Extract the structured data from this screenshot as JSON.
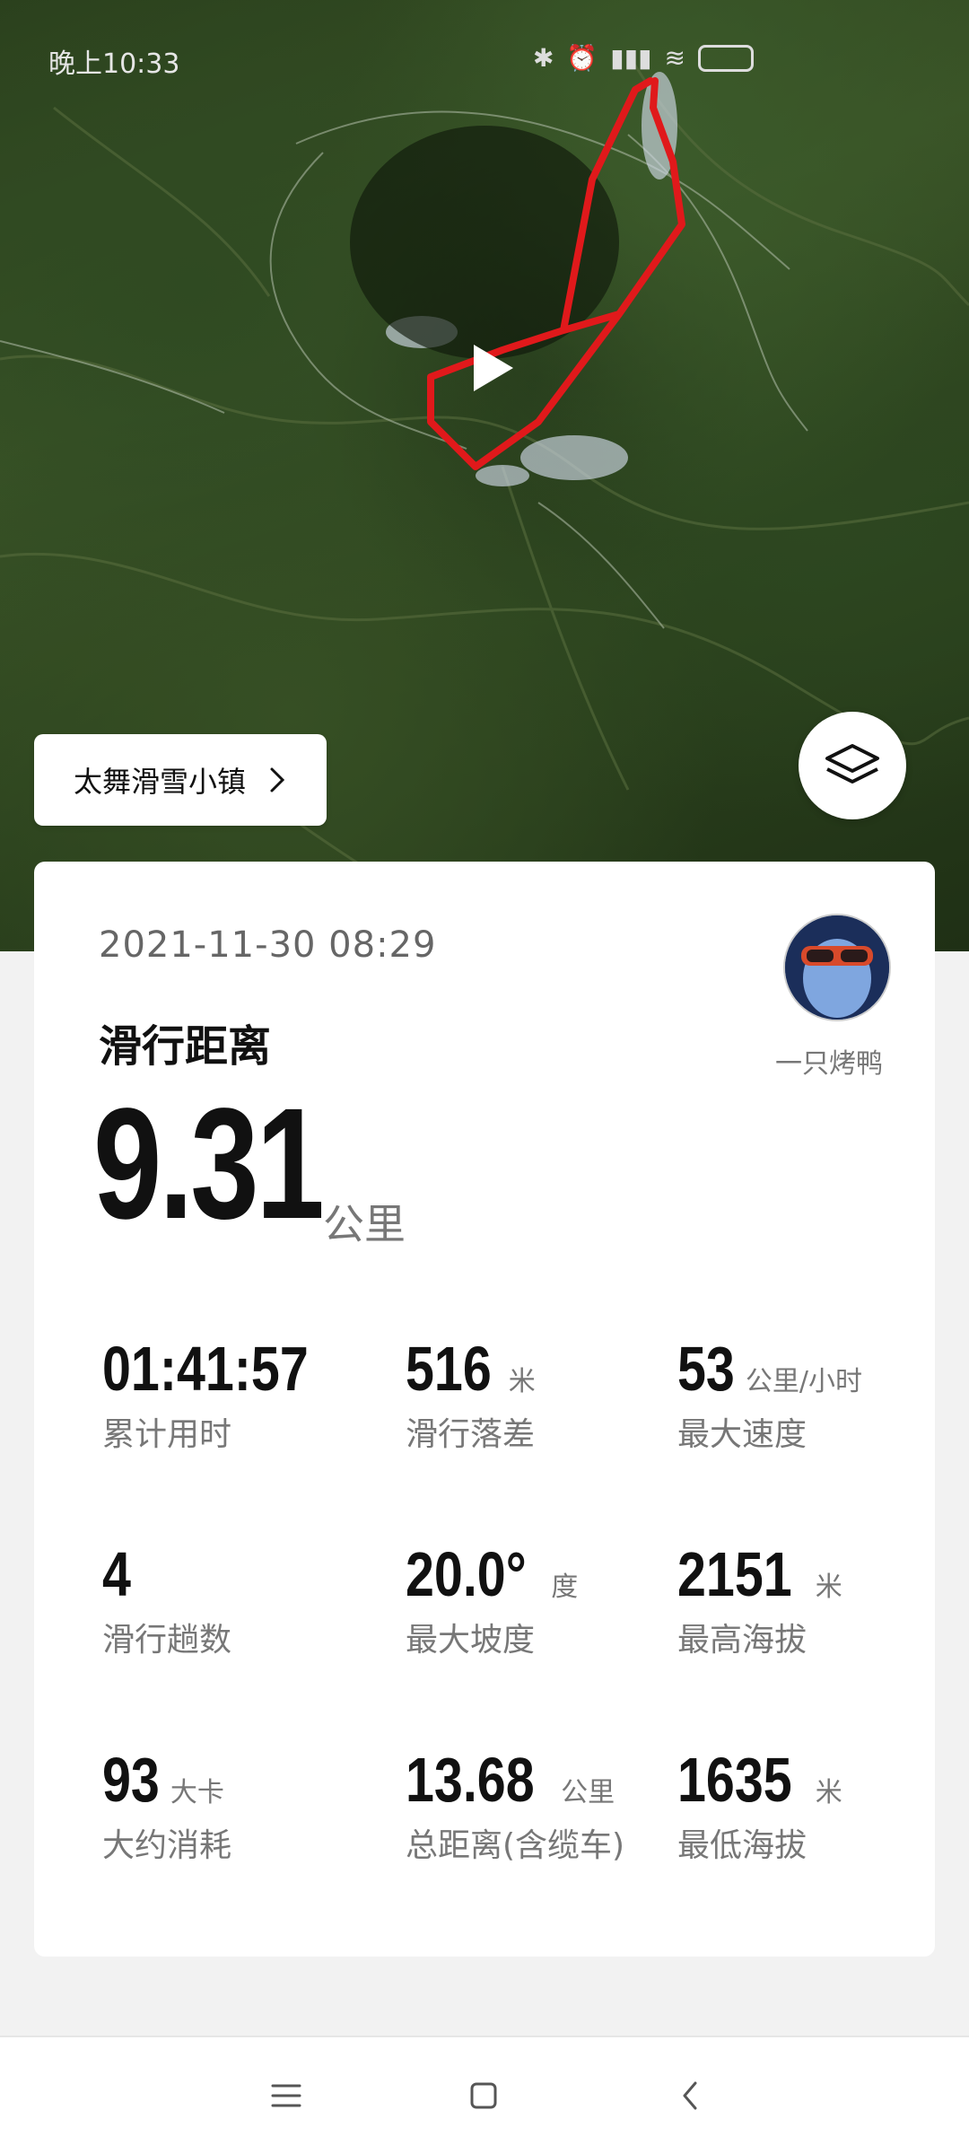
{
  "status_bar": {
    "time": "晚上10:33",
    "icons": [
      "bluetooth-icon",
      "alarm-icon",
      "signal-icon",
      "wifi-icon",
      "battery-icon"
    ]
  },
  "map": {
    "route_color": "#e0191b",
    "location_label": "太舞滑雪小镇"
  },
  "summary": {
    "date": "2021-11-30 08:29",
    "username": "一只烤鸭",
    "metric_title": "滑行距离",
    "distance_value": "9.31",
    "distance_unit": "公里"
  },
  "stats": [
    {
      "value": "01:41:57",
      "unit": "",
      "label": "累计用时"
    },
    {
      "value": "516",
      "unit": "米",
      "label": "滑行落差"
    },
    {
      "value": "53",
      "unit": "公里/小时",
      "label": "最大速度"
    },
    {
      "value": "4",
      "unit": "",
      "label": "滑行趟数"
    },
    {
      "value": "20.0°",
      "unit": "度",
      "label": "最大坡度"
    },
    {
      "value": "2151",
      "unit": "米",
      "label": "最高海拔"
    },
    {
      "value": "93",
      "unit": "大卡",
      "label": "大约消耗"
    },
    {
      "value": "13.68",
      "unit": "公里",
      "label": "总距离(含缆车)"
    },
    {
      "value": "1635",
      "unit": "米",
      "label": "最低海拔"
    }
  ],
  "nav": {
    "items": [
      "menu-icon",
      "home-icon",
      "back-icon"
    ]
  }
}
